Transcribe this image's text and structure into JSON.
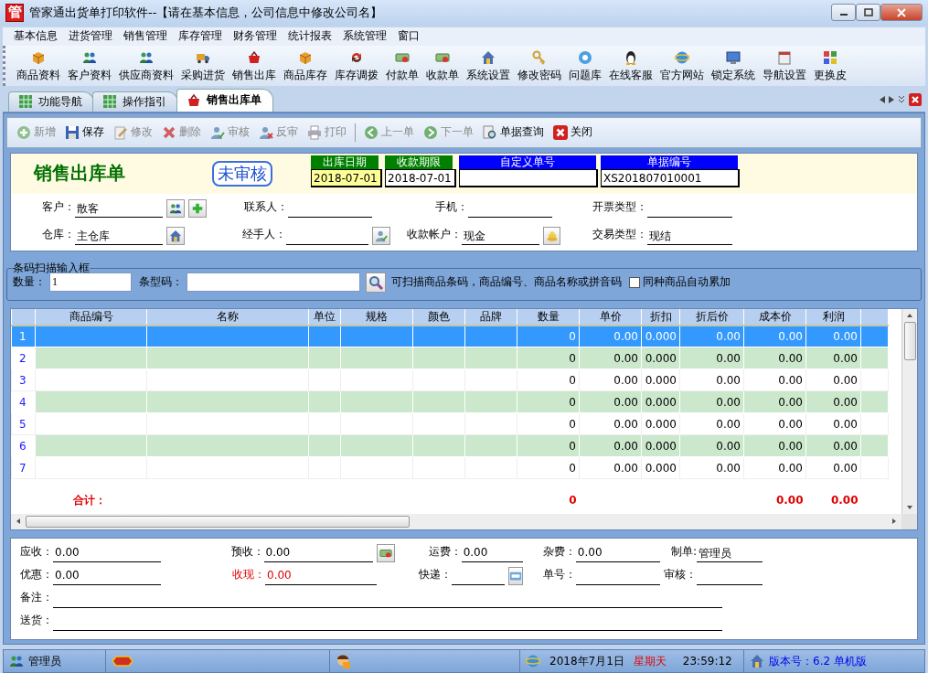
{
  "window": {
    "app_icon": "管",
    "title": "管家通出货单打印软件--【请在基本信息，公司信息中修改公司名】"
  },
  "menu": [
    "基本信息",
    "进货管理",
    "销售管理",
    "库存管理",
    "财务管理",
    "统计报表",
    "系统管理",
    "窗口"
  ],
  "toolbar": [
    "商品资料",
    "客户资料",
    "供应商资料",
    "采购进货",
    "销售出库",
    "商品库存",
    "库存调拨",
    "付款单",
    "收款单",
    "系统设置",
    "修改密码",
    "问题库",
    "在线客服",
    "官方网站",
    "锁定系统",
    "导航设置",
    "更换皮"
  ],
  "tabs": [
    {
      "label": "功能导航",
      "selected": false
    },
    {
      "label": "操作指引",
      "selected": false
    },
    {
      "label": "销售出库单",
      "selected": true
    }
  ],
  "commands": [
    [
      {
        "label": "新增",
        "disabled": true
      },
      {
        "label": "保存",
        "disabled": false
      },
      {
        "label": "修改",
        "disabled": true
      },
      {
        "label": "删除",
        "disabled": true
      },
      {
        "label": "审核",
        "disabled": true
      },
      {
        "label": "反审",
        "disabled": true
      },
      {
        "label": "打印",
        "disabled": true
      }
    ],
    [
      {
        "label": "上一单",
        "disabled": true
      },
      {
        "label": "下一单",
        "disabled": true
      },
      {
        "label": "单据查询",
        "disabled": false
      },
      {
        "label": "关闭",
        "disabled": false
      }
    ]
  ],
  "document": {
    "title": "销售出库单",
    "status": "未审核",
    "header_fields": [
      {
        "label": "出库日期",
        "color": "#008000",
        "value": "2018-07-01",
        "highlighted": true
      },
      {
        "label": "收款期限",
        "color": "#008000",
        "value": "2018-07-01",
        "highlighted": false
      },
      {
        "label": "自定义单号",
        "color": "#0000ff",
        "highlighted": false
      },
      {
        "label": "单据编号",
        "color": "#0000ff",
        "value": "XS201807010001",
        "highlighted": false
      }
    ]
  },
  "fields": [
    [
      {
        "label": "客户：",
        "value": "散客",
        "kind": "customer"
      },
      {
        "label": "联系人：",
        "kind": "plain"
      },
      {
        "label": "手机：",
        "kind": "plain"
      },
      {
        "label": "开票类型：",
        "kind": "plain"
      }
    ],
    [
      {
        "label": "仓库：",
        "value": "主仓库",
        "kind": "warehouse"
      },
      {
        "label": "经手人：",
        "kind": "person"
      },
      {
        "label": "收款帐户：",
        "value": "现金",
        "kind": "account"
      },
      {
        "label": "交易类型：",
        "value": "现结",
        "kind": "plain"
      }
    ]
  ],
  "barcode": {
    "legend": "条码扫描输入框",
    "quantity_label": "数量：",
    "quantity": "1",
    "code_label": "条型码：",
    "hint": "可扫描商品条码，商品编号、商品名称或拼音码",
    "auto_add": {
      "label": "同种商品自动累加",
      "checked": false
    }
  },
  "table": {
    "columns": [
      "商品编号",
      "名称",
      "单位",
      "规格",
      "颜色",
      "品牌",
      "数量",
      "单价",
      "折扣",
      "折后价",
      "成本价",
      "利润"
    ],
    "rows": [
      {
        "number": "1",
        "selected": true,
        "quantity": "0",
        "price": "0.00",
        "discount": "0.000",
        "discounted_price": "0.00",
        "cost_price": "0.00",
        "profit": "0.00"
      },
      {
        "number": "2",
        "selected": false,
        "quantity": "0",
        "price": "0.00",
        "discount": "0.000",
        "discounted_price": "0.00",
        "cost_price": "0.00",
        "profit": "0.00"
      },
      {
        "number": "3",
        "selected": false,
        "quantity": "0",
        "price": "0.00",
        "discount": "0.000",
        "discounted_price": "0.00",
        "cost_price": "0.00",
        "profit": "0.00"
      },
      {
        "number": "4",
        "selected": false,
        "quantity": "0",
        "price": "0.00",
        "discount": "0.000",
        "discounted_price": "0.00",
        "cost_price": "0.00",
        "profit": "0.00"
      },
      {
        "number": "5",
        "selected": false,
        "quantity": "0",
        "price": "0.00",
        "discount": "0.000",
        "discounted_price": "0.00",
        "cost_price": "0.00",
        "profit": "0.00"
      },
      {
        "number": "6",
        "selected": false,
        "quantity": "0",
        "price": "0.00",
        "discount": "0.000",
        "discounted_price": "0.00",
        "cost_price": "0.00",
        "profit": "0.00"
      },
      {
        "number": "7",
        "selected": false,
        "quantity": "0",
        "price": "0.00",
        "discount": "0.000",
        "discounted_price": "0.00",
        "cost_price": "0.00",
        "profit": "0.00"
      }
    ],
    "totals": {
      "label": "合计：",
      "quantity": "0",
      "cost_price": "0.00",
      "profit": "0.00"
    }
  },
  "footer": [
    [
      {
        "label": "应收：",
        "value": "0.00",
        "kind": "plain",
        "highlighted": false
      },
      {
        "label": "预收：",
        "value": "0.00",
        "kind": "money",
        "highlighted": false
      },
      {
        "label": "运费：",
        "value": "0.00",
        "kind": "plain",
        "highlighted": false
      },
      {
        "label": "杂费：",
        "value": "0.00",
        "kind": "plain",
        "highlighted": false
      },
      {
        "label": "制单:",
        "value": "管理员",
        "kind": "plain",
        "highlighted": false
      }
    ],
    [
      {
        "label": "优惠：",
        "value": "0.00",
        "kind": "plain",
        "highlighted": false
      },
      {
        "label": "收现：",
        "value": "0.00",
        "kind": "plain",
        "highlighted": true
      },
      {
        "label": "快递：",
        "kind": "express",
        "highlighted": false
      },
      {
        "label": "单号：",
        "kind": "plain",
        "highlighted": false
      },
      {
        "label": "审核：",
        "kind": "plain",
        "highlighted": false
      }
    ]
  ],
  "notes": [
    {
      "label": "备注："
    },
    {
      "label": "送货："
    }
  ],
  "status_bar": {
    "user": "管理员",
    "date": "2018年7月1日",
    "weekday": "星期天",
    "time": "23:59:12",
    "version": "版本号：6.2 单机版"
  }
}
